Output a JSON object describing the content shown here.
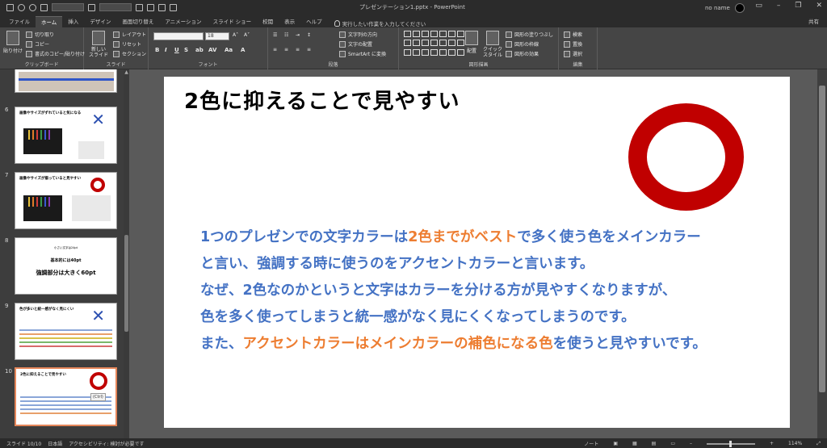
{
  "window": {
    "title": "プレゼンテーション1.pptx - PowerPoint",
    "user": "no name",
    "share": "共有"
  },
  "tabs": [
    "ファイル",
    "ホーム",
    "挿入",
    "デザイン",
    "画面切り替え",
    "アニメーション",
    "スライド ショー",
    "校閲",
    "表示",
    "ヘルプ"
  ],
  "active_tab": "ホーム",
  "tellme": "実行したい作業を入力してください",
  "ribbon": {
    "clipboard": {
      "label": "クリップボード",
      "paste": "貼り付け",
      "cut": "切り取り",
      "copy": "コピー",
      "format_painter": "書式のコピー/貼り付け"
    },
    "slides": {
      "label": "スライド",
      "new_slide": "新しい スライド",
      "layout": "レイアウト",
      "reset": "リセット",
      "section": "セクション"
    },
    "font": {
      "label": "フォント",
      "size": "18"
    },
    "paragraph": {
      "label": "段落",
      "text_direction": "文字列の方向",
      "align_text": "文字の配置",
      "smartart": "SmartArt に変換"
    },
    "drawing": {
      "label": "図形描画",
      "arrange": "配置",
      "quick_styles": "クイック スタイル",
      "fill": "図形の塗りつぶし",
      "outline": "図形の枠線",
      "effects": "図形の効果"
    },
    "editing": {
      "label": "編集",
      "find": "検索",
      "replace": "置換",
      "select": "選択"
    }
  },
  "thumbnails": [
    {
      "num": "6",
      "title": "画像やサイズがずれていると気になる"
    },
    {
      "num": "7",
      "title": "画像やサイズが揃っていると見やすい"
    },
    {
      "num": "8",
      "line1": "小さい文字は24pt",
      "line2": "基本的には40pt",
      "line3": "強調部分は大きく60pt"
    },
    {
      "num": "9",
      "title": "色が多いと統一感がなく見にくい"
    },
    {
      "num": "10",
      "title": "2色に抑えることで見やすい",
      "ctrl": "(Ctrl)"
    }
  ],
  "slide": {
    "title": "2色に抑えることで見やすい",
    "line1_a": "1つのプレゼンでの文字カラーは",
    "line1_hl": "2色までがベスト",
    "line1_b": "で多く使う色をメインカラー",
    "line2": "と言い、強調する時に使うのをアクセントカラーと言います。",
    "line3": "なぜ、2色なのかというと文字はカラーを分ける方が見やすくなりますが、",
    "line4": "色を多く使ってしまうと統一感がなく見にくくなってしまうのです。",
    "line5_a": "また、",
    "line5_hl": "アクセントカラーはメインカラーの補色になる色",
    "line5_b": "を使うと見やすいです。",
    "colors": {
      "main": "#4472c4",
      "accent": "#ed7d31",
      "ring": "#c00000"
    }
  },
  "status": {
    "slide_count": "スライド 10/10",
    "language": "日本語",
    "accessibility": "アクセシビリティ: 検討が必要です",
    "notes": "ノート",
    "zoom": "114%"
  }
}
